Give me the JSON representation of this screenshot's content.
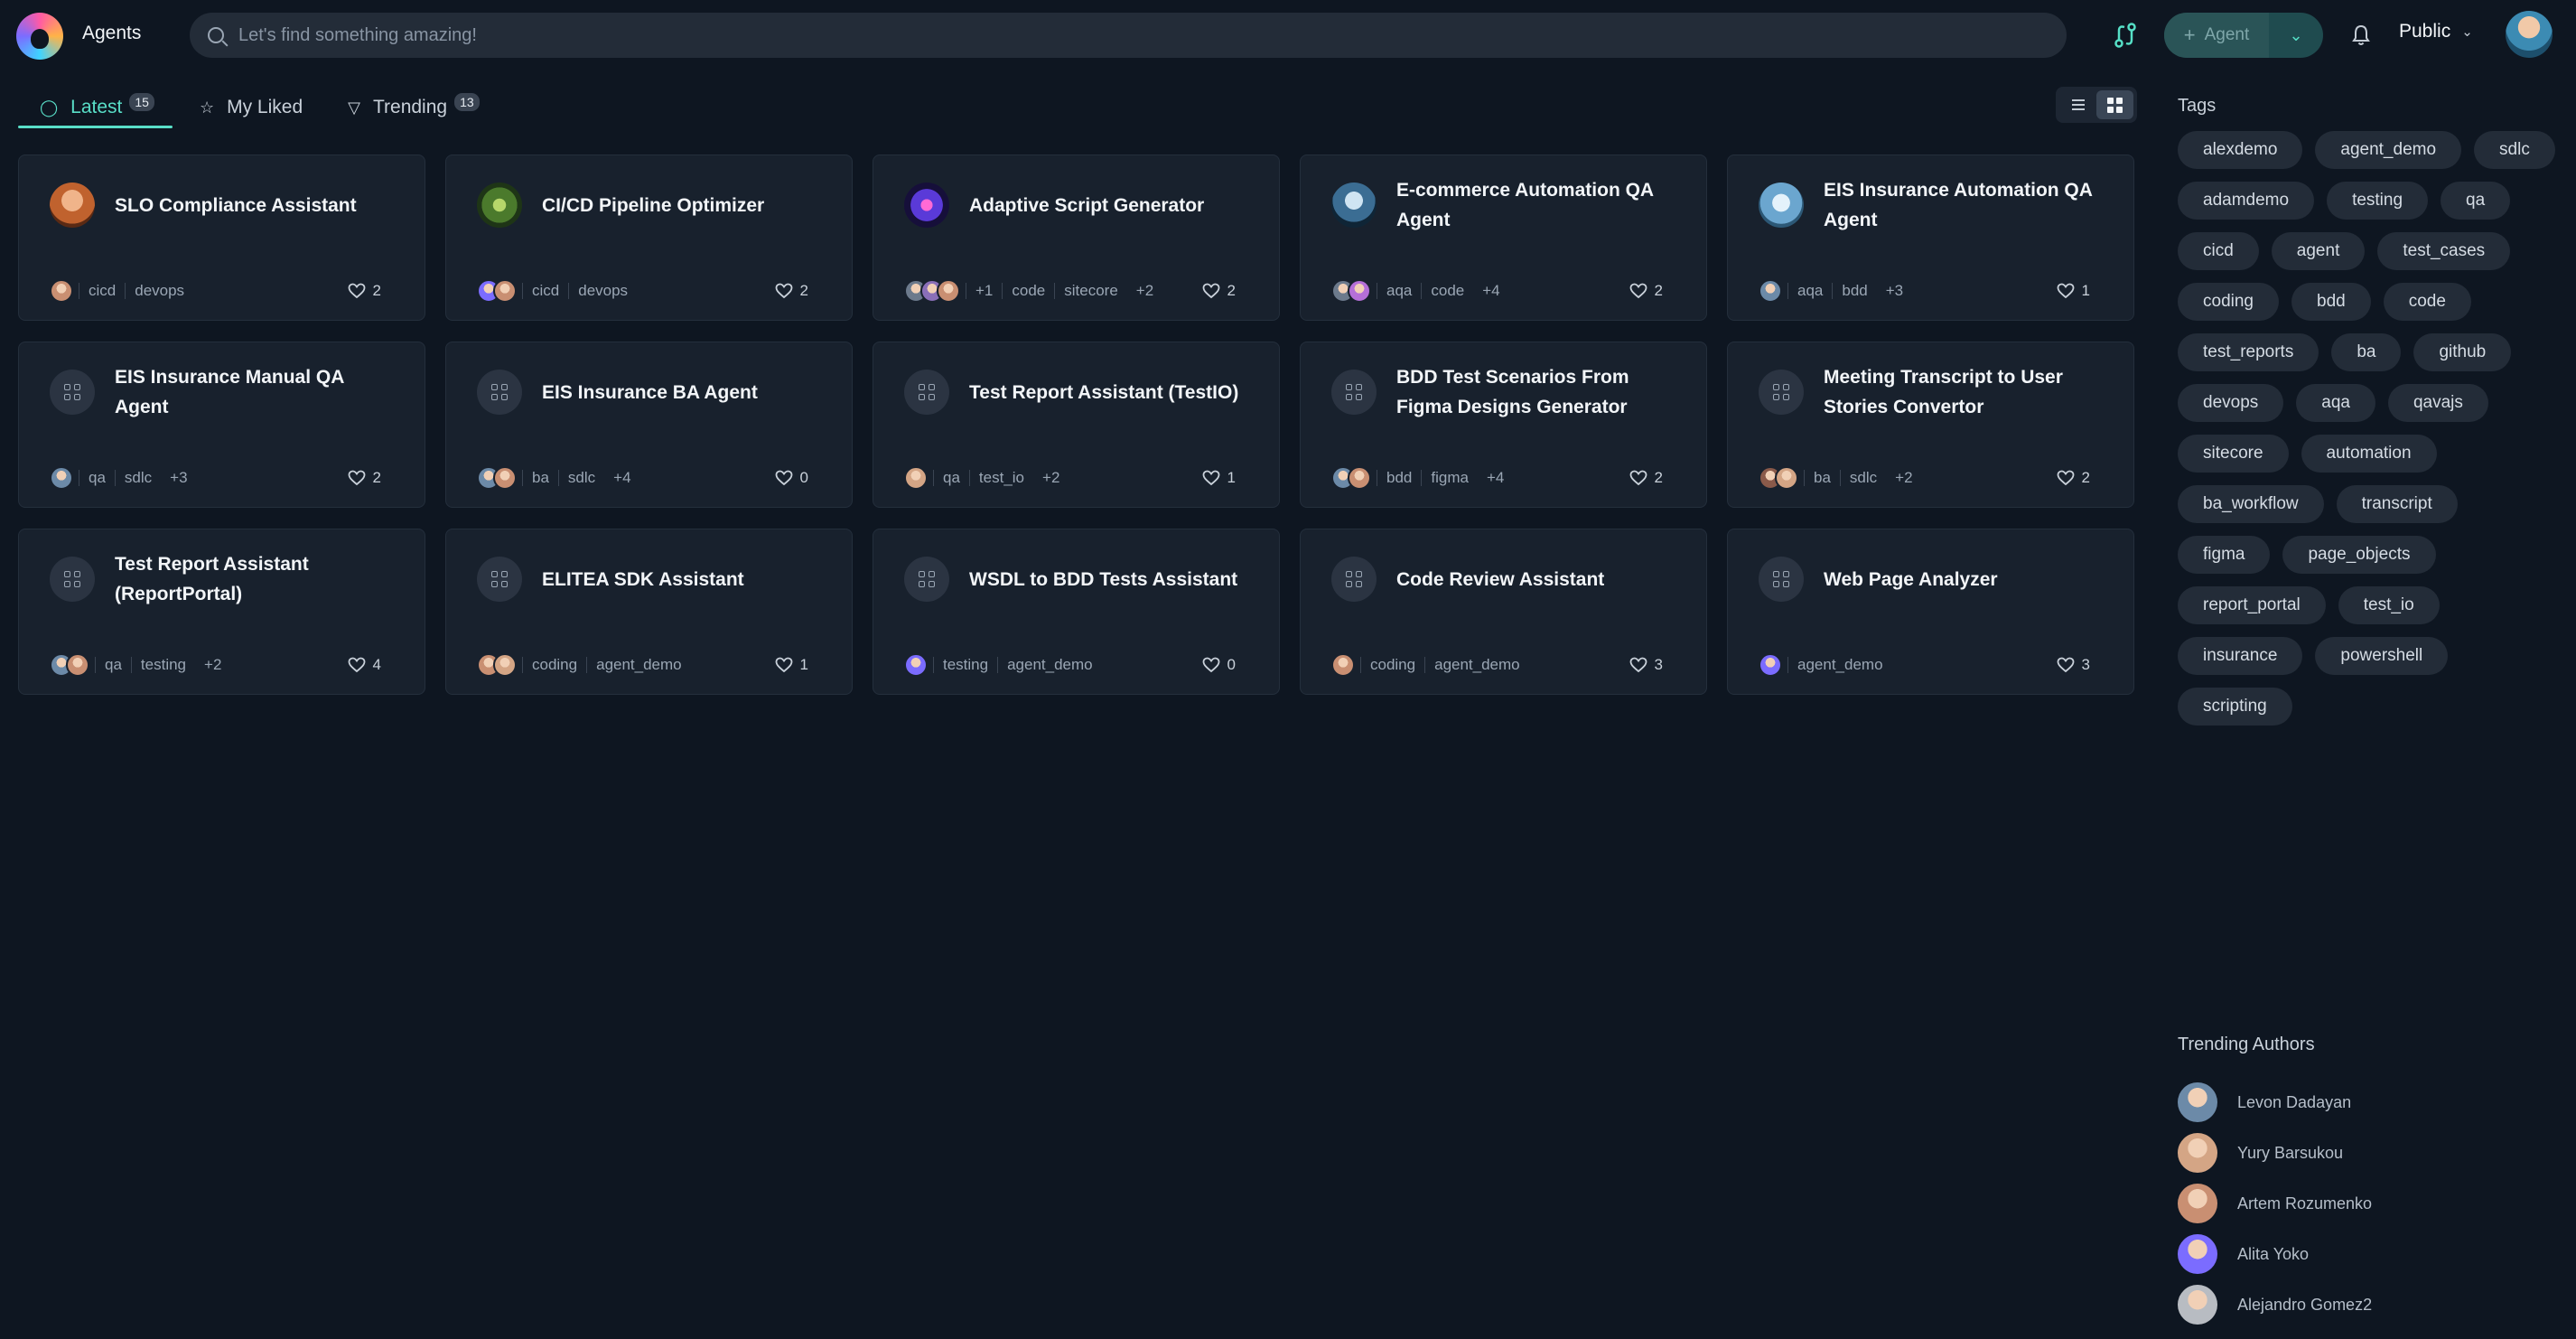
{
  "header": {
    "title": "Agents",
    "search_placeholder": "Let's find something amazing!",
    "agent_button_label": "Agent",
    "visibility_label": "Public"
  },
  "tabs": [
    {
      "label": "Latest",
      "count": "15"
    },
    {
      "label": "My Liked",
      "count": ""
    },
    {
      "label": "Trending",
      "count": "13"
    }
  ],
  "cards": [
    {
      "title": "SLO Compliance Assistant",
      "avatar": "portrait-warm",
      "authors": [
        "#c98f72"
      ],
      "more": "",
      "tags": [
        "cicd",
        "devops"
      ],
      "tags_more": "",
      "likes": "2"
    },
    {
      "title": "CI/CD Pipeline Optimizer",
      "avatar": "green-tech",
      "authors": [
        "#7b6cff",
        "#c98f72"
      ],
      "more": "",
      "tags": [
        "cicd",
        "devops"
      ],
      "tags_more": "",
      "likes": "2"
    },
    {
      "title": "Adaptive Script Generator",
      "avatar": "purple-burst",
      "authors": [
        "#6c7a8c",
        "#8a6fb8",
        "#c98f72"
      ],
      "more": "+1",
      "tags": [
        "code",
        "sitecore"
      ],
      "tags_more": "+2",
      "likes": "2"
    },
    {
      "title": "E-commerce Automation QA Agent",
      "avatar": "robot-blue",
      "authors": [
        "#6c7a8c",
        "#b56fd8"
      ],
      "more": "",
      "tags": [
        "aqa",
        "code"
      ],
      "tags_more": "+4",
      "likes": "2"
    },
    {
      "title": "EIS Insurance Automation QA Agent",
      "avatar": "robot-light",
      "authors": [
        "#6c8aa8"
      ],
      "more": "",
      "tags": [
        "aqa",
        "bdd"
      ],
      "tags_more": "+3",
      "likes": "1"
    },
    {
      "title": "EIS Insurance Manual QA Agent",
      "avatar": "placeholder",
      "authors": [
        "#6c8aa8"
      ],
      "more": "",
      "tags": [
        "qa",
        "sdlc"
      ],
      "tags_more": "+3",
      "likes": "2"
    },
    {
      "title": "EIS Insurance BA Agent",
      "avatar": "placeholder",
      "authors": [
        "#6c8aa8",
        "#c98f72"
      ],
      "more": "",
      "tags": [
        "ba",
        "sdlc"
      ],
      "tags_more": "+4",
      "likes": "0"
    },
    {
      "title": "Test Report Assistant (TestIO)",
      "avatar": "placeholder",
      "authors": [
        "#d4a585"
      ],
      "more": "",
      "tags": [
        "qa",
        "test_io"
      ],
      "tags_more": "+2",
      "likes": "1"
    },
    {
      "title": "BDD Test Scenarios From Figma Designs Generator",
      "avatar": "placeholder",
      "authors": [
        "#6c8aa8",
        "#c98f72"
      ],
      "more": "",
      "tags": [
        "bdd",
        "figma"
      ],
      "tags_more": "+4",
      "likes": "2"
    },
    {
      "title": "Meeting Transcript to User Stories Convertor",
      "avatar": "placeholder",
      "authors": [
        "#8a5a4a",
        "#d4a585"
      ],
      "more": "",
      "tags": [
        "ba",
        "sdlc"
      ],
      "tags_more": "+2",
      "likes": "2"
    },
    {
      "title": "Test Report Assistant (ReportPortal)",
      "avatar": "placeholder",
      "authors": [
        "#6c8aa8",
        "#c98f72"
      ],
      "more": "",
      "tags": [
        "qa",
        "testing"
      ],
      "tags_more": "+2",
      "likes": "4"
    },
    {
      "title": "ELITEA SDK Assistant",
      "avatar": "placeholder",
      "authors": [
        "#c98f72",
        "#d4a585"
      ],
      "more": "",
      "tags": [
        "coding",
        "agent_demo"
      ],
      "tags_more": "",
      "likes": "1"
    },
    {
      "title": "WSDL to BDD Tests Assistant",
      "avatar": "placeholder",
      "authors": [
        "#7b6cff"
      ],
      "more": "",
      "tags": [
        "testing",
        "agent_demo"
      ],
      "tags_more": "",
      "likes": "0"
    },
    {
      "title": "Code Review Assistant",
      "avatar": "placeholder",
      "authors": [
        "#c98f72"
      ],
      "more": "",
      "tags": [
        "coding",
        "agent_demo"
      ],
      "tags_more": "",
      "likes": "3"
    },
    {
      "title": "Web Page Analyzer",
      "avatar": "placeholder",
      "authors": [
        "#7b6cff"
      ],
      "more": "",
      "tags": [
        "agent_demo"
      ],
      "tags_more": "",
      "likes": "3"
    }
  ],
  "sidebar": {
    "tags_title": "Tags",
    "tags": [
      "alexdemo",
      "agent_demo",
      "sdlc",
      "adamdemo",
      "testing",
      "qa",
      "cicd",
      "agent",
      "test_cases",
      "coding",
      "bdd",
      "code",
      "test_reports",
      "ba",
      "github",
      "devops",
      "aqa",
      "qavajs",
      "sitecore",
      "automation",
      "ba_workflow",
      "transcript",
      "figma",
      "page_objects",
      "report_portal",
      "test_io",
      "insurance",
      "powershell",
      "scripting"
    ],
    "authors_title": "Trending Authors",
    "authors": [
      {
        "name": "Levon Dadayan",
        "color": "#6c8aa8"
      },
      {
        "name": "Yury Barsukou",
        "color": "#d4a585"
      },
      {
        "name": "Artem Rozumenko",
        "color": "#c98f72"
      },
      {
        "name": "Alita Yoko",
        "color": "#7b6cff"
      },
      {
        "name": "Alejandro Gomez2",
        "color": "#b8bcc2"
      }
    ]
  }
}
